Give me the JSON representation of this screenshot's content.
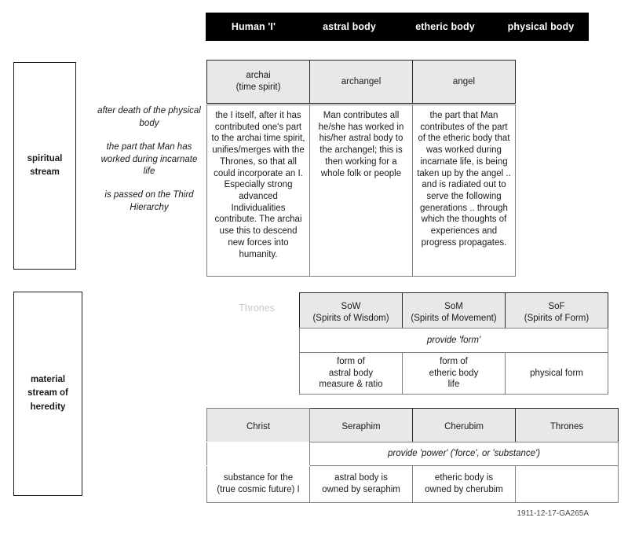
{
  "header": {
    "columns": [
      {
        "label": "Human 'I'"
      },
      {
        "label": "astral body"
      },
      {
        "label": "etheric body"
      },
      {
        "label": "physical body"
      }
    ]
  },
  "streams": {
    "spiritual": "spiritual\nstream",
    "spiritual_line1": "spiritual",
    "spiritual_line2": "stream",
    "material_line1": "material",
    "material_line2": "stream of",
    "material_line3": "heredity"
  },
  "notes": {
    "note1": "after death of the physical body",
    "note2": "the part that Man has worked during incarnate life",
    "note3": "is passed on the Third Hierarchy"
  },
  "hierarchy_row": {
    "cells": [
      {
        "line1": "archai",
        "line2": "(time spirit)"
      },
      {
        "line1": "archangel",
        "line2": ""
      },
      {
        "line1": "angel",
        "line2": ""
      }
    ]
  },
  "description_row": {
    "cells": [
      {
        "text": "the I itself, after it has contributed one's part to the archai time spirit, unifies/merges with the Thrones, so that all could incorporate an I. Especially strong advanced Individualities contribute. The archai use this to descend new forces into humanity."
      },
      {
        "text": "Man contributes all he/she has worked in his/her astral body to the archangel; this is then working for a whole folk or people"
      },
      {
        "text": "the part that Man contributes of the part of the etheric body that was worked during incarnate life, is being taken up by the angel .. and is radiated out to serve the following generations .. through which the thoughts of experiences and progress propagates."
      }
    ]
  },
  "thrones_label": "Thrones",
  "form_section": {
    "headers": [
      {
        "line1": "SoW",
        "line2": "(Spirits of Wisdom)"
      },
      {
        "line1": "SoM",
        "line2": "(Spirits of Movement)"
      },
      {
        "line1": "SoF",
        "line2": "(Spirits of Form)"
      }
    ],
    "banner": "provide 'form'",
    "body": [
      {
        "line1": "form of",
        "line2": "astral body",
        "line3": "measure & ratio"
      },
      {
        "line1": "form of",
        "line2": "etheric body",
        "line3": "life"
      },
      {
        "line1": "physical form",
        "line2": "",
        "line3": ""
      }
    ]
  },
  "power_section": {
    "headers": [
      {
        "label": "Christ"
      },
      {
        "label": "Seraphim"
      },
      {
        "label": "Cherubim"
      },
      {
        "label": "Thrones"
      }
    ],
    "banner": "provide 'power' ('force', or 'substance')",
    "body": [
      {
        "line1": "substance for the",
        "line2": "(true cosmic future) I"
      },
      {
        "line1": "astral body is",
        "line2": "owned by seraphim"
      },
      {
        "line1": "etheric body is",
        "line2": "owned by cherubim"
      },
      {
        "line1": "",
        "line2": ""
      }
    ]
  },
  "footnote": "1911-12-17-GA265A",
  "colors": {
    "header_bar": "#000000",
    "header_text": "#ffffff",
    "cell_gray": "#e8e8e8",
    "border": "#7f7f7f",
    "border_dark": "#262626",
    "muted_label": "#c9c9c9"
  }
}
